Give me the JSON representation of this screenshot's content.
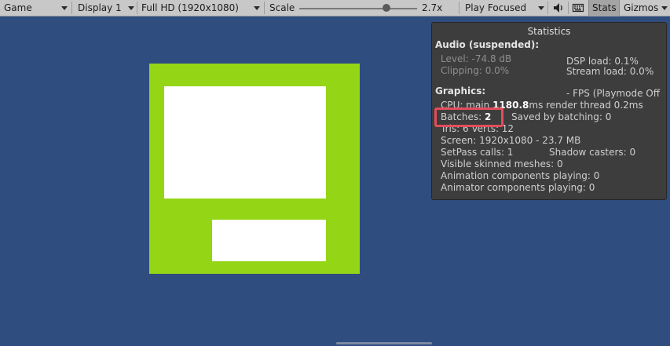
{
  "toolbar": {
    "view_label": "Game",
    "display_label": "Display 1",
    "resolution_label": "Full HD (1920x1080)",
    "scale_label": "Scale",
    "scale_value": "2.7x",
    "scale_level": 0.74,
    "play_mode_label": "Play Focused",
    "stats_label": "Stats",
    "gizmos_label": "Gizmos",
    "icons": [
      "speaker-icon",
      "keyboard-icon"
    ]
  },
  "stats": {
    "title": "Statistics",
    "audio_heading": "Audio (suspended):",
    "level": "Level: -74.8 dB",
    "clipping": "Clipping: 0.0%",
    "dsp_load": "DSP load: 0.1%",
    "stream_load": "Stream load: 0.0%",
    "graphics_heading": "Graphics:",
    "fps": "- FPS (Playmode Off",
    "cpu_prefix": "CPU: main ",
    "cpu_main_value": "1180.8",
    "cpu_suffix": "ms  render thread 0.2ms",
    "batches_prefix": "Batches: ",
    "batches_value": "2",
    "saved_by_batching": "Saved by batching: 0",
    "tris_verts": "Tris: 6  Verts: 12",
    "screen": "Screen: 1920x1080 - 23.7 MB",
    "setpass": "SetPass calls: 1",
    "shadow_casters": "Shadow casters: 0",
    "skinned_meshes": "Visible skinned meshes: 0",
    "animation_components": "Animation components playing: 0",
    "animator_components": "Animator components playing: 0"
  },
  "colors": {
    "background": "#2f4d7e",
    "green": "#94d516",
    "highlight": "#e24d5c"
  }
}
